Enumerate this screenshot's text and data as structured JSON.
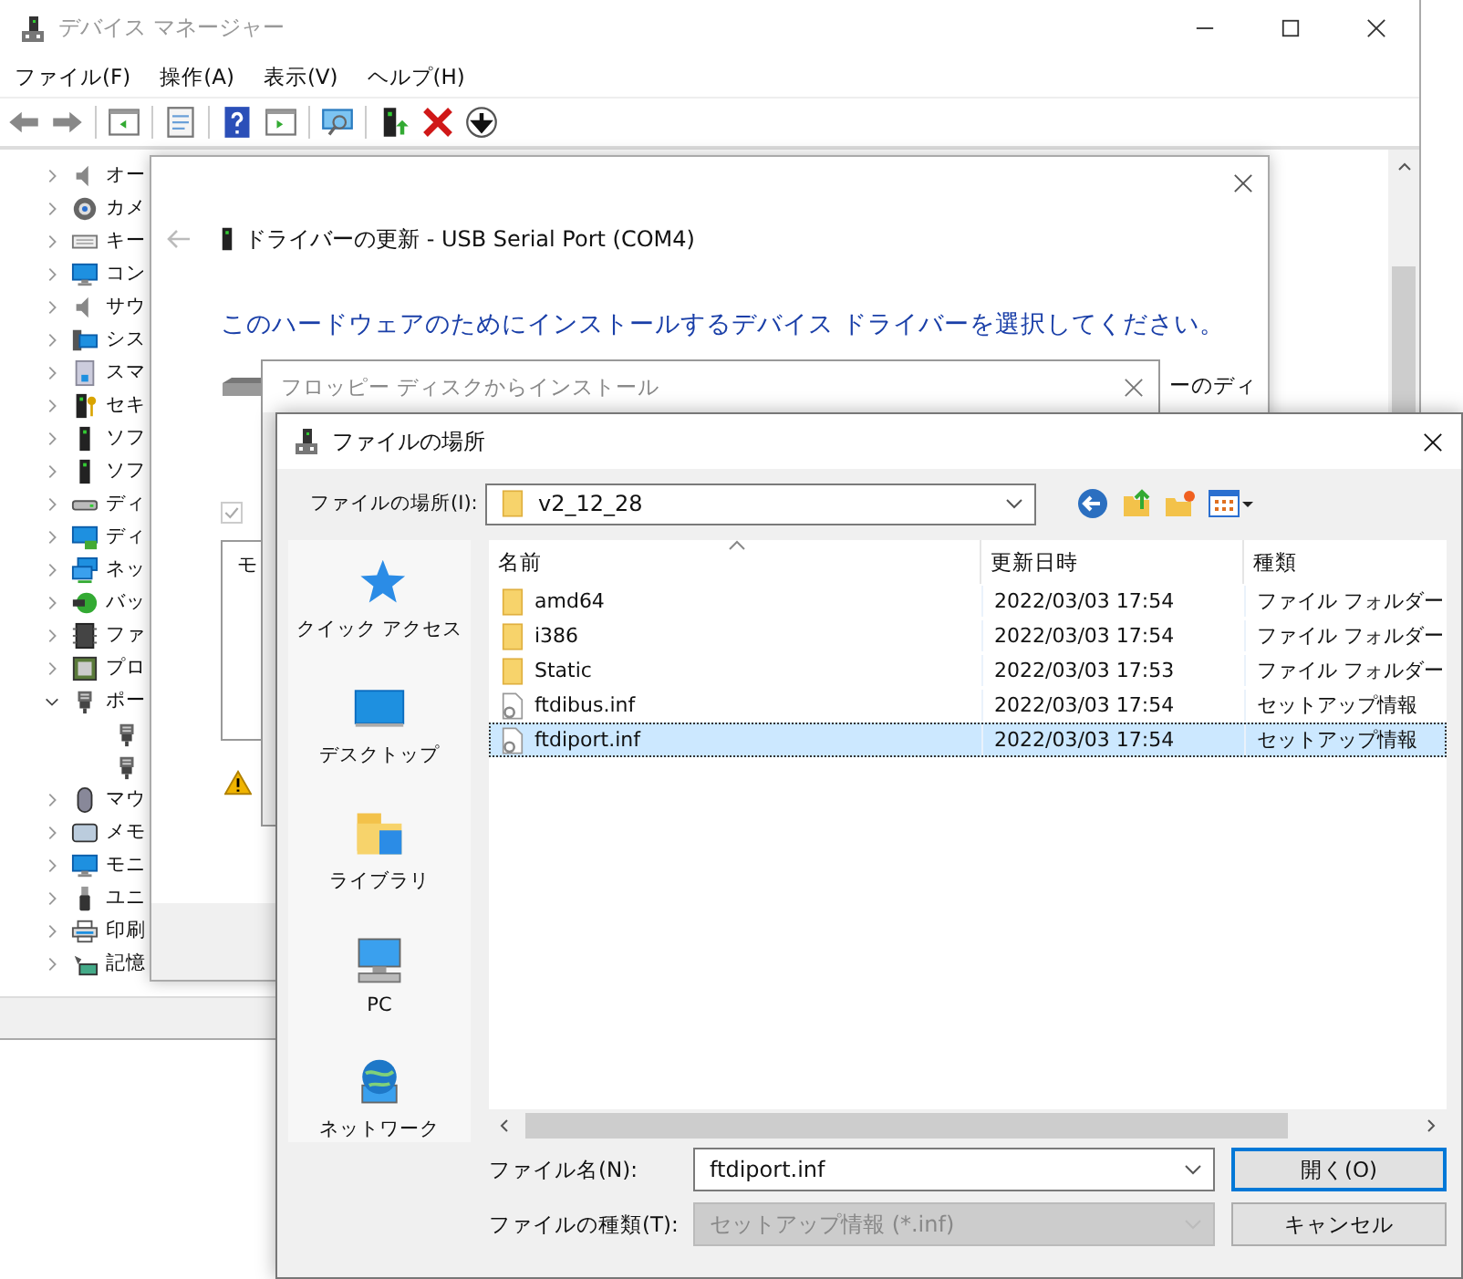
{
  "device_manager": {
    "title": "デバイス マネージャー",
    "menu": [
      "ファイル(F)",
      "操作(A)",
      "表示(V)",
      "ヘルプ(H)"
    ],
    "tree": [
      {
        "label": "オー",
        "expanded": false
      },
      {
        "label": "カメ",
        "expanded": false
      },
      {
        "label": "キー",
        "expanded": false
      },
      {
        "label": "コン",
        "expanded": false
      },
      {
        "label": "サウ",
        "expanded": false
      },
      {
        "label": "シス",
        "expanded": false
      },
      {
        "label": "スマ",
        "expanded": false
      },
      {
        "label": "セキ",
        "expanded": false
      },
      {
        "label": "ソフ",
        "expanded": false
      },
      {
        "label": "ソフ",
        "expanded": false
      },
      {
        "label": "ディ",
        "expanded": false
      },
      {
        "label": "ディ",
        "expanded": false
      },
      {
        "label": "ネッ",
        "expanded": false
      },
      {
        "label": "バッ",
        "expanded": false
      },
      {
        "label": "ファ",
        "expanded": false
      },
      {
        "label": "プロ",
        "expanded": false
      },
      {
        "label": "ポー",
        "expanded": true,
        "children": [
          {
            "kind": "port"
          },
          {
            "kind": "port"
          }
        ]
      },
      {
        "label": "マウ",
        "expanded": false
      },
      {
        "label": "メモ",
        "expanded": false
      },
      {
        "label": "モニ",
        "expanded": false
      },
      {
        "label": "ユニ",
        "expanded": false
      },
      {
        "label": "印刷",
        "expanded": false
      },
      {
        "label": "記憶",
        "expanded": false
      }
    ]
  },
  "driver_update": {
    "title": "ドライバーの更新 - USB Serial Port (COM4)",
    "heading": "このハードウェアのためにインストールするデバイス ドライバーを選択してください。",
    "side_text": "ーのディ",
    "compatible_checkbox": {
      "checked": true
    },
    "list_text": "モ"
  },
  "floppy_dialog": {
    "title": "フロッピー ディスクからインストール"
  },
  "file_dialog": {
    "title": "ファイルの場所",
    "location_label": "ファイルの場所(I):",
    "location": "v2_12_28",
    "places": [
      "クイック アクセス",
      "デスクトップ",
      "ライブラリ",
      "PC",
      "ネットワーク"
    ],
    "columns": [
      "名前",
      "更新日時",
      "種類"
    ],
    "files": [
      {
        "kind": "folder",
        "name": "amd64",
        "modified": "2022/03/03 17:54",
        "type": "ファイル フォルダー",
        "selected": false
      },
      {
        "kind": "folder",
        "name": "i386",
        "modified": "2022/03/03 17:54",
        "type": "ファイル フォルダー",
        "selected": false
      },
      {
        "kind": "folder",
        "name": "Static",
        "modified": "2022/03/03 17:53",
        "type": "ファイル フォルダー",
        "selected": false
      },
      {
        "kind": "setup",
        "name": "ftdibus.inf",
        "modified": "2022/03/03 17:54",
        "type": "セットアップ情報",
        "selected": false
      },
      {
        "kind": "setup",
        "name": "ftdiport.inf",
        "modified": "2022/03/03 17:54",
        "type": "セットアップ情報",
        "selected": true
      }
    ],
    "filename_label": "ファイル名(N):",
    "filename": "ftdiport.inf",
    "filetype_label": "ファイルの種類(T):",
    "filetype": "セットアップ情報 (*.inf)",
    "buttons": [
      "開く(O)",
      "キャンセル"
    ]
  }
}
